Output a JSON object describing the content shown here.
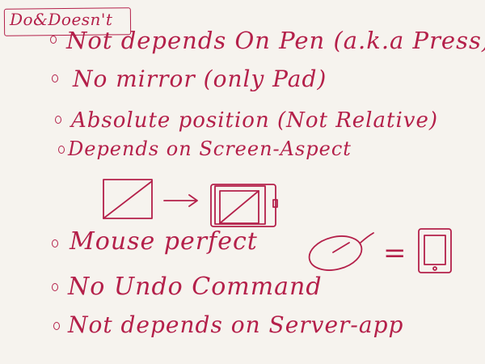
{
  "note": {
    "title": "Do&Doesn't",
    "items": [
      "Not depends On Pen (a.k.a Press)",
      "No mirror (only Pad)",
      "Absolute position (Not Relative)",
      "Depends on Screen-Aspect",
      "Mouse perfect",
      "No Undo Command",
      "Not depends on Server-app"
    ],
    "equals_sign": "="
  },
  "colors": {
    "ink": "#b4204a",
    "paper": "#f6f3ee"
  }
}
